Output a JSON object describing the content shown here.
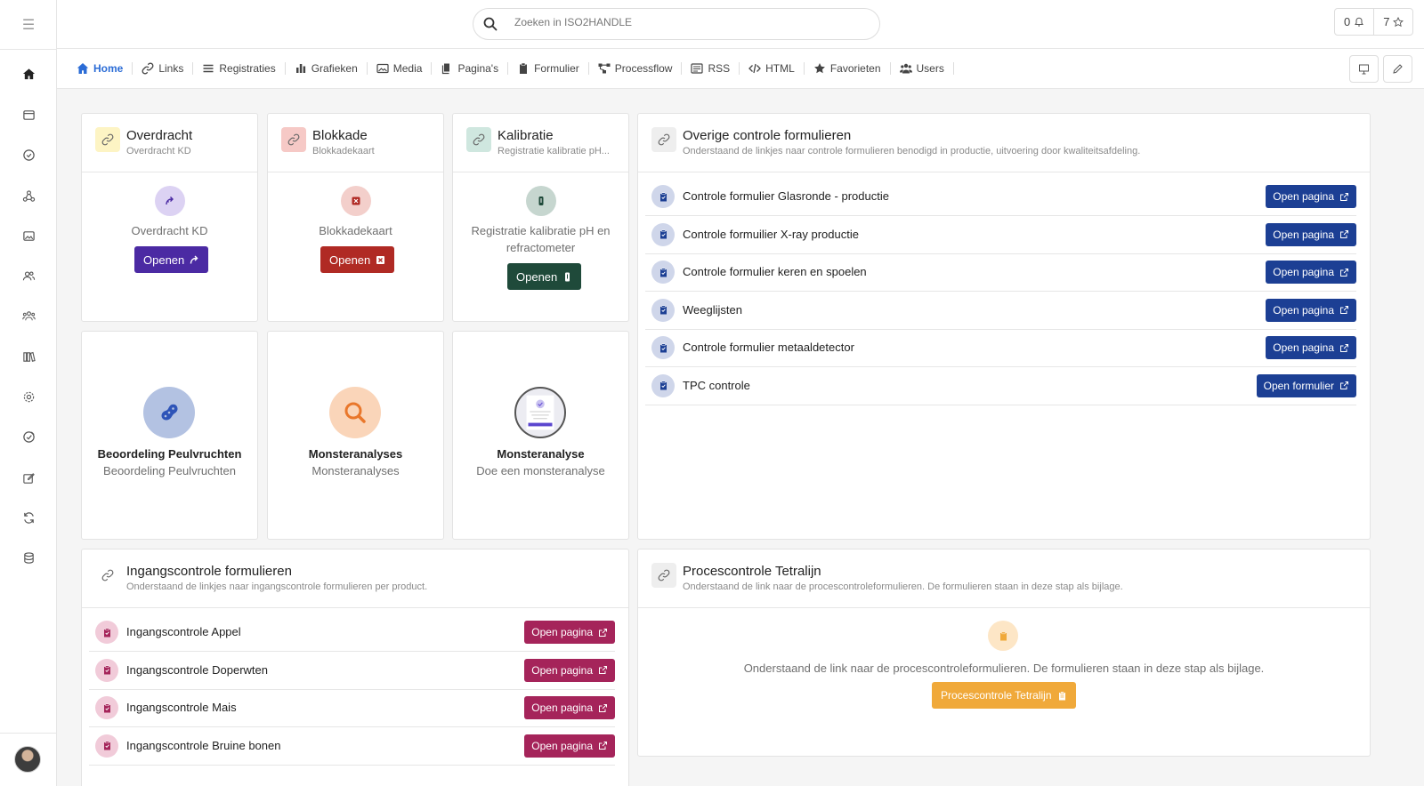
{
  "search": {
    "placeholder": "Zoeken in ISO2HANDLE"
  },
  "header": {
    "notifications_count": "0",
    "favorites_count": "7"
  },
  "nav": {
    "items": [
      {
        "label": "Home",
        "icon": "home-icon",
        "active": true
      },
      {
        "label": "Links",
        "icon": "link-icon"
      },
      {
        "label": "Registraties",
        "icon": "list-icon"
      },
      {
        "label": "Grafieken",
        "icon": "bar-chart-icon"
      },
      {
        "label": "Media",
        "icon": "images-icon"
      },
      {
        "label": "Pagina's",
        "icon": "pages-icon"
      },
      {
        "label": "Formulier",
        "icon": "clipboard-icon"
      },
      {
        "label": "Processflow",
        "icon": "flow-icon"
      },
      {
        "label": "RSS",
        "icon": "rss-icon"
      },
      {
        "label": "HTML",
        "icon": "code-icon"
      },
      {
        "label": "Favorieten",
        "icon": "star-icon"
      },
      {
        "label": "Users",
        "icon": "users-icon"
      }
    ]
  },
  "cards": {
    "overdracht": {
      "title": "Overdracht",
      "subtitle": "Overdracht KD",
      "text": "Overdracht KD",
      "button": "Openen",
      "color": "#4b2aa3"
    },
    "blokkade": {
      "title": "Blokkade",
      "subtitle": "Blokkadekaart",
      "text": "Blokkadekaart",
      "button": "Openen",
      "color": "#b02a24"
    },
    "kalibratie": {
      "title": "Kalibratie",
      "subtitle": "Registratie kalibratie pH...",
      "text_line1": "Registratie kalibratie pH en",
      "text_line2": "refractometer",
      "button": "Openen",
      "color": "#1f4a3a"
    }
  },
  "tiles": [
    {
      "title": "Beoordeling Peulvruchten",
      "subtitle": "Beoordeling Peulvruchten"
    },
    {
      "title": "Monsteranalyses",
      "subtitle": "Monsteranalyses"
    },
    {
      "title": "Monsteranalyse",
      "subtitle": "Doe een monsteranalyse"
    }
  ],
  "overige": {
    "title": "Overige controle formulieren",
    "subtitle": "Onderstaand de linkjes naar controle formulieren benodigd in productie, uitvoering door kwaliteitsafdeling.",
    "rows": [
      {
        "label": "Controle formulier Glasronde - productie",
        "button": "Open pagina"
      },
      {
        "label": "Controle formuilier X-ray productie",
        "button": "Open pagina"
      },
      {
        "label": "Controle formulier keren en spoelen",
        "button": "Open pagina"
      },
      {
        "label": "Weeglijsten",
        "button": "Open pagina"
      },
      {
        "label": "Controle formulier metaaldetector",
        "button": "Open pagina"
      },
      {
        "label": "TPC controle",
        "button": "Open formulier"
      }
    ],
    "color": "#1c3f94"
  },
  "ingang": {
    "title": "Ingangscontrole formulieren",
    "subtitle": "Onderstaand de linkjes naar ingangscontrole formulieren per product.",
    "rows": [
      {
        "label": "Ingangscontrole Appel",
        "button": "Open pagina"
      },
      {
        "label": "Ingangscontrole Doperwten",
        "button": "Open pagina"
      },
      {
        "label": "Ingangscontrole Mais",
        "button": "Open pagina"
      },
      {
        "label": "Ingangscontrole Bruine bonen",
        "button": "Open pagina"
      }
    ],
    "color": "#a5245a"
  },
  "proces": {
    "title": "Procescontrole Tetralijn",
    "subtitle": "Onderstaand de link naar de procescontroleformulieren. De formulieren staan in deze stap als bijlage.",
    "text": "Onderstaand de link naar de procescontroleformulieren. De formulieren staan in deze stap als bijlage.",
    "button": "Procescontrole Tetralijn",
    "color": "#f0a93a"
  }
}
